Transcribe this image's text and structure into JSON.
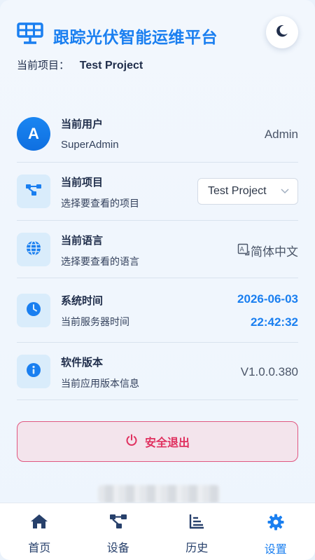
{
  "header": {
    "title": "跟踪光伏智能运维平台",
    "project_label": "当前项目：",
    "project_value": "Test Project"
  },
  "rows": {
    "user": {
      "avatar_letter": "A",
      "title": "当前用户",
      "sub": "SuperAdmin",
      "value": "Admin"
    },
    "project": {
      "title": "当前项目",
      "sub": "选择要查看的项目",
      "selected": "Test Project"
    },
    "language": {
      "title": "当前语言",
      "sub": "选择要查看的语言",
      "value": "简体中文"
    },
    "time": {
      "title": "系统时间",
      "sub": "当前服务器时间",
      "date": "2026-06-03",
      "clock": "22:42:32"
    },
    "version": {
      "title": "软件版本",
      "sub": "当前应用版本信息",
      "value": "V1.0.0.380"
    }
  },
  "logout_label": "安全退出",
  "nav": {
    "items": [
      {
        "label": "首页",
        "icon": "home-icon"
      },
      {
        "label": "设备",
        "icon": "device-icon"
      },
      {
        "label": "历史",
        "icon": "history-icon"
      },
      {
        "label": "设置",
        "icon": "settings-icon"
      }
    ],
    "active_index": 3
  },
  "colors": {
    "accent": "#1a7ff0",
    "danger": "#e0305f",
    "nav_text": "#27406b"
  }
}
